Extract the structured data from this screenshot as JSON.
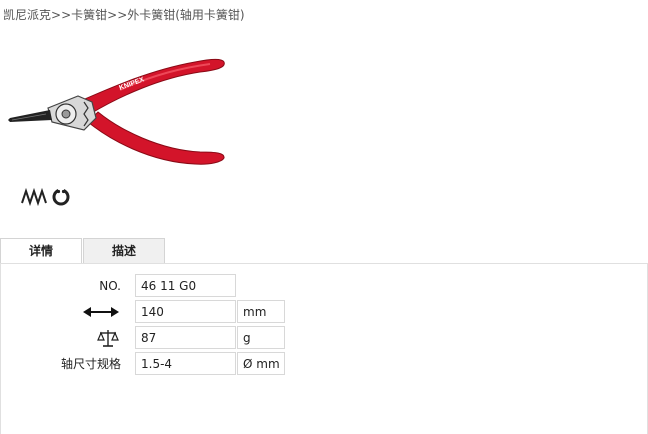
{
  "breadcrumb": {
    "items": [
      "凯尼派克",
      "卡簧钳",
      "外卡簧钳(轴用卡簧钳)"
    ],
    "separator": ">>"
  },
  "product": {
    "image_alt": "KNIPEX external circlip pliers",
    "brand_text": "KNIPEX",
    "handle_color": "#d3142a",
    "feature_icons": [
      "spring-icon",
      "ring-icon"
    ]
  },
  "tabs": [
    {
      "label": "详情",
      "active": true
    },
    {
      "label": "描述",
      "active": false
    }
  ],
  "specs": [
    {
      "label": "NO.",
      "icon": null,
      "value": "46 11 G0",
      "unit": ""
    },
    {
      "label": "",
      "icon": "length-arrow-icon",
      "value": "140",
      "unit": "mm"
    },
    {
      "label": "",
      "icon": "scale-weight-icon",
      "value": "87",
      "unit": "g"
    },
    {
      "label": "轴尺寸规格",
      "icon": null,
      "value": "1.5-4",
      "unit": "Ø mm"
    }
  ]
}
